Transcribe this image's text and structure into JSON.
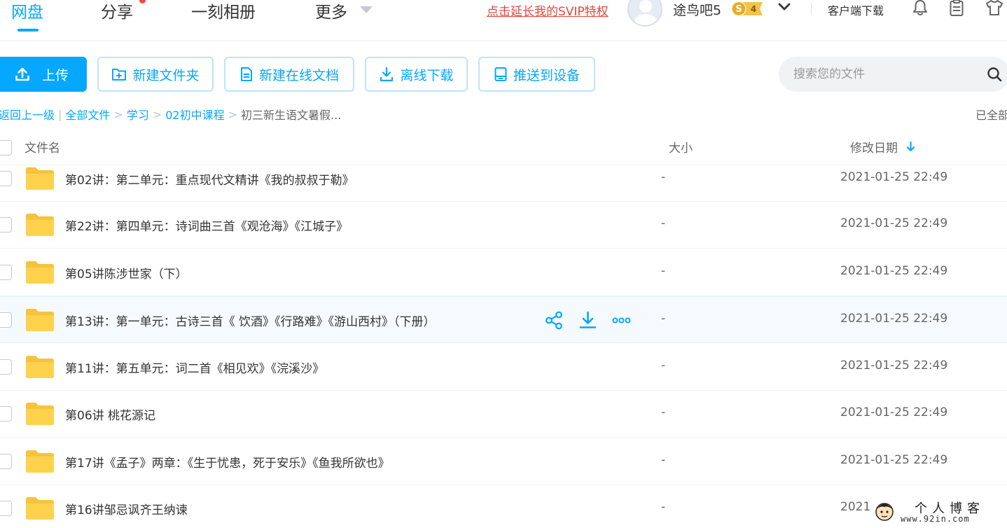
{
  "nav": {
    "tabs": [
      "网盘",
      "分享",
      "一刻相册",
      "更多"
    ],
    "active_tab": "网盘",
    "svip_link": "点击延长我的SVIP特权",
    "username": "途鸟吧5",
    "vip_badge_letter": "S",
    "vip_level": "4",
    "client_download": "客户端下载"
  },
  "toolbar": {
    "upload": "上传",
    "new_folder": "新建文件夹",
    "new_doc": "新建在线文档",
    "offline_download": "离线下载",
    "push_device": "推送到设备",
    "search_placeholder": "搜索您的文件"
  },
  "breadcrumb": {
    "back": "返回上一级",
    "items": [
      "全部文件",
      "学习",
      "02初中课程"
    ],
    "current": "初三新生语文暑假...",
    "loaded_status": "已全部"
  },
  "list": {
    "headers": {
      "name": "文件名",
      "size": "大小",
      "modified": "修改日期"
    },
    "rows": [
      {
        "name": "第02讲：第二单元：重点现代文精讲《我的叔叔于勒》",
        "size": "-",
        "modified": "2021-01-25 22:49"
      },
      {
        "name": "第22讲：第四单元：诗词曲三首《观沧海》《江城子》",
        "size": "-",
        "modified": "2021-01-25 22:49"
      },
      {
        "name": "第05讲陈涉世家（下）",
        "size": "-",
        "modified": "2021-01-25 22:49"
      },
      {
        "name": "第13讲：第一单元：古诗三首《 饮酒》《行路难》《游山西村》（下册）",
        "size": "-",
        "modified": "2021-01-25 22:49"
      },
      {
        "name": "第11讲：第五单元：词二首《相见欢》《浣溪沙》",
        "size": "-",
        "modified": "2021-01-25 22:49"
      },
      {
        "name": "第06讲 桃花源记",
        "size": "-",
        "modified": "2021-01-25 22:49"
      },
      {
        "name": "第17讲《孟子》两章：《生于忧患，死于安乐》《鱼我所欲也》",
        "size": "-",
        "modified": "2021-01-25 22:49"
      },
      {
        "name": "第16讲邹忌讽齐王纳谏",
        "size": "-",
        "modified": "2021"
      }
    ],
    "hover_row_index": 3
  },
  "watermark": {
    "title": "个人博客",
    "url": "www.92in.com"
  },
  "colors": {
    "accent": "#06a7ff",
    "svip_link": "#e5473a",
    "folder": "#ffd24d",
    "vip_badge": "#f2c24a"
  }
}
